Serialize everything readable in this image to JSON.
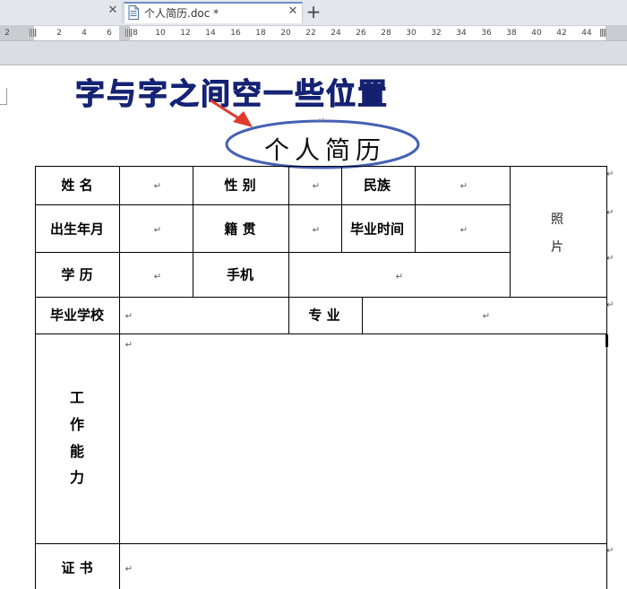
{
  "tabs": {
    "active_title": "个人简历.doc *",
    "close_glyph": "✕",
    "new_tab_glyph": "+"
  },
  "ruler": {
    "ticks": [
      "2",
      "2",
      "4",
      "6",
      "8",
      "10",
      "12",
      "14",
      "16",
      "18",
      "20",
      "22",
      "24",
      "26",
      "28",
      "30",
      "32",
      "34",
      "36",
      "38",
      "40",
      "42",
      "44"
    ]
  },
  "annotation": {
    "text": "字与字之间空一些位置",
    "color": "#23349e",
    "ellipse_color": "#4561b5",
    "arrow_color": "#e03a2f"
  },
  "document": {
    "title": "个人简历",
    "paragraph_mark": "↵",
    "table": {
      "name_label": "姓 名",
      "gender_label": "性 别",
      "ethnicity_label": "民族",
      "birth_label": "出生年月",
      "native_place_label": "籍 贯",
      "graduation_time_label": "毕业时间",
      "education_label": "学 历",
      "phone_label": "手机",
      "school_label": "毕业学校",
      "major_label": "专 业",
      "work_ability_label": [
        "工",
        "作",
        "能",
        "力"
      ],
      "photo_label": [
        "照",
        "片"
      ],
      "certificate_label": "证  书"
    }
  }
}
